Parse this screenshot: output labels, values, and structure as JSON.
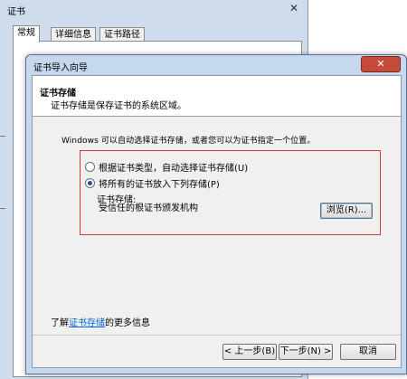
{
  "background_window": {
    "title": "证书",
    "close_glyph": "✕",
    "tabs": [
      {
        "label": "常规"
      },
      {
        "label": "详细信息"
      },
      {
        "label": "证书路径"
      }
    ]
  },
  "wizard": {
    "title": "证书导入向导",
    "close_glyph": "✕",
    "header": {
      "title": "证书存储",
      "subtitle": "证书存储是保存证书的系统区域。"
    },
    "intro": "Windows 可以自动选择证书存储，或者您可以为证书指定一个位置。",
    "options": [
      {
        "label": "根据证书类型，自动选择证书存储(U)",
        "checked": false
      },
      {
        "label": "将所有的证书放入下列存储(P)",
        "checked": true
      }
    ],
    "store_label": "证书存储:",
    "store_value": "受信任的根证书颁发机构",
    "browse_label": "浏览(R)...",
    "learn_prefix": "了解",
    "learn_link": "证书存储",
    "learn_suffix": "的更多信息",
    "buttons": {
      "back": "< 上一步(B)",
      "next": "下一步(N) >",
      "cancel": "取消"
    }
  },
  "colors": {
    "accent_highlight": "#d23a3a",
    "link": "#0066cc",
    "close_button": "#c44b3a"
  }
}
